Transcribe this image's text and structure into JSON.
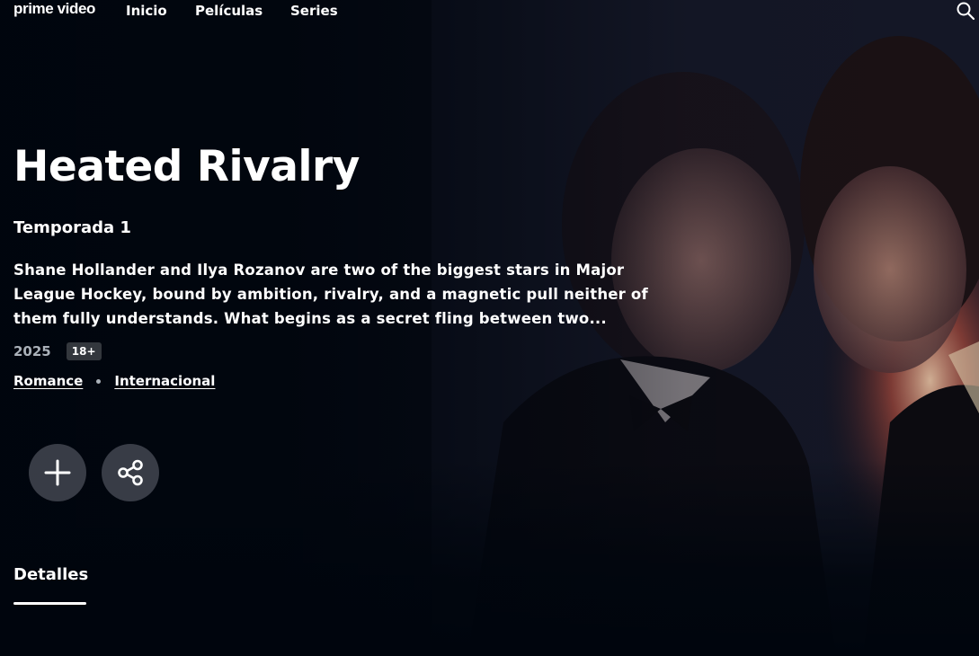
{
  "brand": {
    "logo_text": "prime video"
  },
  "nav": {
    "items": [
      {
        "label": "Inicio"
      },
      {
        "label": "Películas"
      },
      {
        "label": "Series"
      }
    ],
    "search_icon": "search-icon"
  },
  "show": {
    "title": "Heated Rivalry",
    "season": "Temporada 1",
    "synopsis": "Shane Hollander and Ilya Rozanov are two of the biggest stars in Major League Hockey, bound by ambition, rivalry, and a magnetic pull neither of them fully understands. What begins as a secret fling between two...",
    "year": "2025",
    "rating": "18+",
    "genres": [
      {
        "label": "Romance"
      },
      {
        "label": "Internacional"
      }
    ]
  },
  "actions": {
    "add_icon": "plus-icon",
    "share_icon": "share-icon"
  },
  "tabs": [
    {
      "label": "Detalles",
      "active": true
    }
  ],
  "colors": {
    "background": "#00050d",
    "meta_text": "#aab1b9",
    "rating_badge_bg": "#33373d",
    "action_button_bg": "#424750"
  }
}
